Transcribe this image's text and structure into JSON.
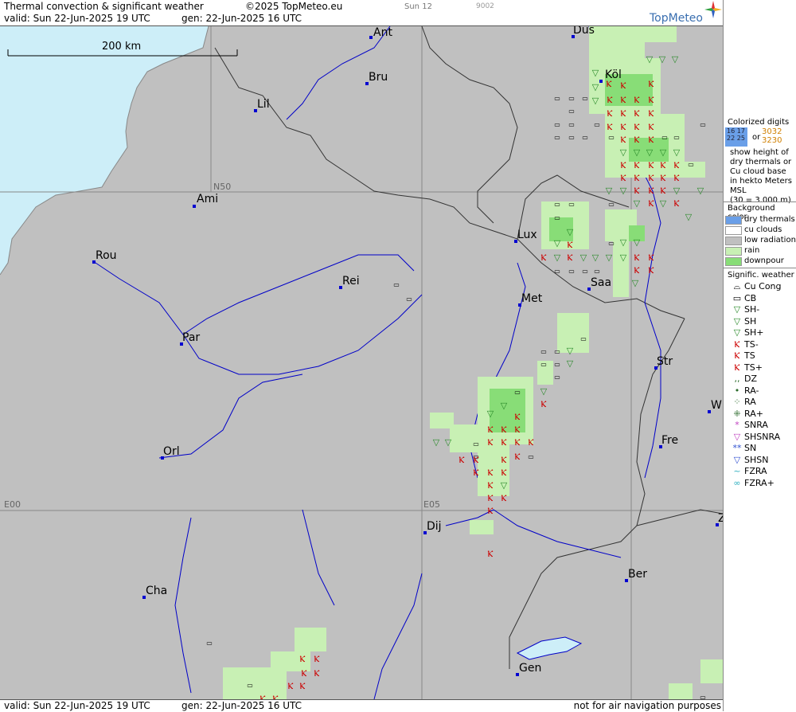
{
  "header": {
    "title": "Thermal convection & significant weather",
    "copyright": "©2025 TopMeteo.eu",
    "valid": "valid:  Sun  22-Jun-2025  19 UTC",
    "generated": "gen: 22-Jun-2025 16 UTC",
    "run_id": "Sun 12",
    "run_code": "9002",
    "logo": "TopMeteo"
  },
  "footer": {
    "valid": "valid:  Sun  22-Jun-2025  19 UTC",
    "generated": "gen: 22-Jun-2025 16 UTC",
    "note": "not for air navigation purposes"
  },
  "scale": {
    "label": "200 km"
  },
  "grid_labels": {
    "lat50": "N50",
    "lon0": "E00",
    "lon5": "E05"
  },
  "cities": [
    {
      "id": "ant",
      "label": "Ant"
    },
    {
      "id": "dus",
      "label": "Düs"
    },
    {
      "id": "bru",
      "label": "Bru"
    },
    {
      "id": "kol",
      "label": "Köl"
    },
    {
      "id": "lil",
      "label": "Lil"
    },
    {
      "id": "ami",
      "label": "Ami"
    },
    {
      "id": "lux",
      "label": "Lux"
    },
    {
      "id": "rou",
      "label": "Rou"
    },
    {
      "id": "rei",
      "label": "Rei"
    },
    {
      "id": "saa",
      "label": "Saa"
    },
    {
      "id": "met",
      "label": "Met"
    },
    {
      "id": "par",
      "label": "Par"
    },
    {
      "id": "str",
      "label": "Str"
    },
    {
      "id": "wu",
      "label": "W"
    },
    {
      "id": "fre",
      "label": "Fre"
    },
    {
      "id": "orl",
      "label": "Orl"
    },
    {
      "id": "dij",
      "label": "Dij"
    },
    {
      "id": "zu",
      "label": "Z"
    },
    {
      "id": "ber",
      "label": "Ber"
    },
    {
      "id": "cha",
      "label": "Cha"
    },
    {
      "id": "gen",
      "label": "Gen"
    }
  ],
  "legend": {
    "colorized_title": [
      "Colorized digits",
      "show height of",
      "dry thermals or",
      "Cu cloud base",
      "in hekto Meters",
      "MSL",
      "(30 = 3.000 m)"
    ],
    "sample_blue_top": "16 17",
    "sample_blue_bottom": "22 25",
    "sample_or": "or",
    "sample_orange_top": "3032",
    "sample_orange_bottom": "3230",
    "bg_title": "Background color",
    "bg_items": [
      {
        "label": "dry thermals",
        "color": "#6a9fe8"
      },
      {
        "label": "cu clouds",
        "color": "#ffffff"
      },
      {
        "label": "low radiation",
        "color": "#c0c0c0"
      },
      {
        "label": "rain",
        "color": "#c8f0b4"
      },
      {
        "label": "downpour",
        "color": "#88dd77"
      }
    ],
    "sig_title": "Signific. weather",
    "sig_items": [
      {
        "label": "Cu Cong",
        "icon": "cu-cong-icon"
      },
      {
        "label": "CB",
        "icon": "cb-icon"
      },
      {
        "label": "SH-",
        "icon": "shower-light-icon"
      },
      {
        "label": "SH",
        "icon": "shower-icon"
      },
      {
        "label": "SH+",
        "icon": "shower-heavy-icon"
      },
      {
        "label": "TS-",
        "icon": "thunderstorm-light-icon"
      },
      {
        "label": "TS",
        "icon": "thunderstorm-icon"
      },
      {
        "label": "TS+",
        "icon": "thunderstorm-heavy-icon"
      },
      {
        "label": "DZ",
        "icon": "drizzle-icon"
      },
      {
        "label": "RA-",
        "icon": "rain-light-icon"
      },
      {
        "label": "RA",
        "icon": "rain-icon"
      },
      {
        "label": "RA+",
        "icon": "rain-heavy-icon"
      },
      {
        "label": "SNRA",
        "icon": "snow-rain-icon"
      },
      {
        "label": "SHSNRA",
        "icon": "snow-rain-shower-icon"
      },
      {
        "label": "SN",
        "icon": "snow-icon"
      },
      {
        "label": "SHSN",
        "icon": "snow-shower-icon"
      },
      {
        "label": "FZRA",
        "icon": "freezing-rain-icon"
      },
      {
        "label": "FZRA+",
        "icon": "freezing-rain-heavy-icon"
      }
    ]
  }
}
